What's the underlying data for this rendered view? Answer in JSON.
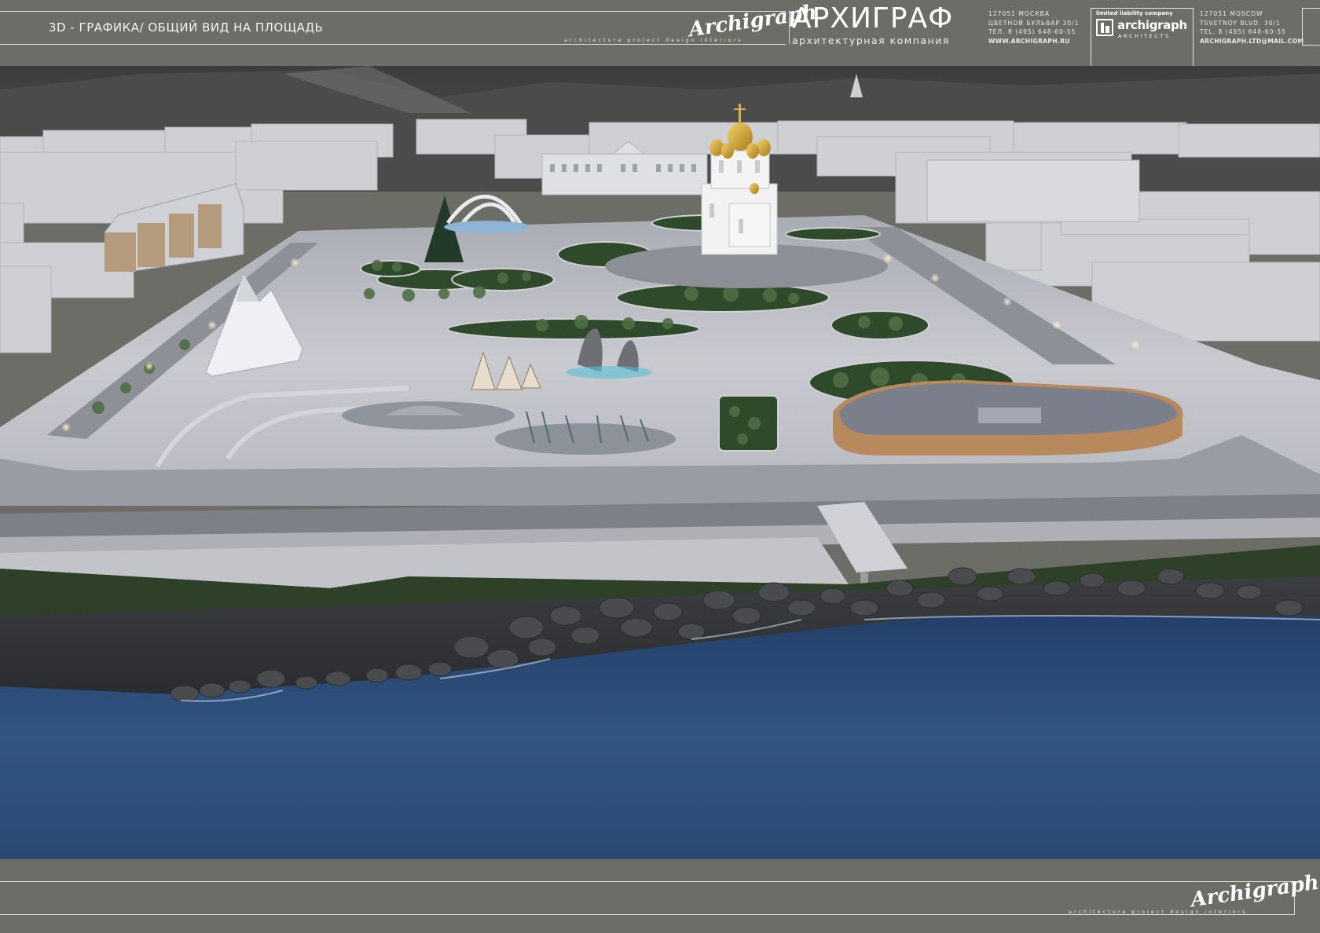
{
  "header": {
    "sheet_title": "3D - ГРАФИКА/ ОБЩИЙ ВИД НА ПЛОЩАДЬ",
    "signature": "Archigraph",
    "signature_tagline": "architecture project design interiors",
    "brand_name": "АРХИГРАФ",
    "brand_subtitle": "архитектурная компания",
    "address_ru": [
      "127051 МОСКВА",
      "ЦВЕТНОЙ БУЛЬВАР 30/1",
      "ТЕЛ. 8 (495) 648-60-55",
      "WWW.ARCHIGRAPH.RU"
    ],
    "logo": {
      "llc_text": "limited liability company",
      "wordmark": "archigraph",
      "architects": "ARCHITECTS"
    },
    "address_en": [
      "127051 MOSCOW",
      "TSVETNOY BLVD. 30/1",
      "TEL. 8 (495) 648-60-55",
      "ARCHIGRAPH.LTD@MAIL.COM"
    ]
  },
  "render": {
    "icon": "aerial-render-image"
  },
  "footer": {
    "signature": "Archigraph",
    "signature_tagline": "architecture project design interiors"
  },
  "colors": {
    "frame": "#6b6d66",
    "rule_line": "#d8d8d2",
    "water": "#2f4c78",
    "plaza": "#bfc0c6",
    "sky_mountains": "#4a4a48"
  }
}
